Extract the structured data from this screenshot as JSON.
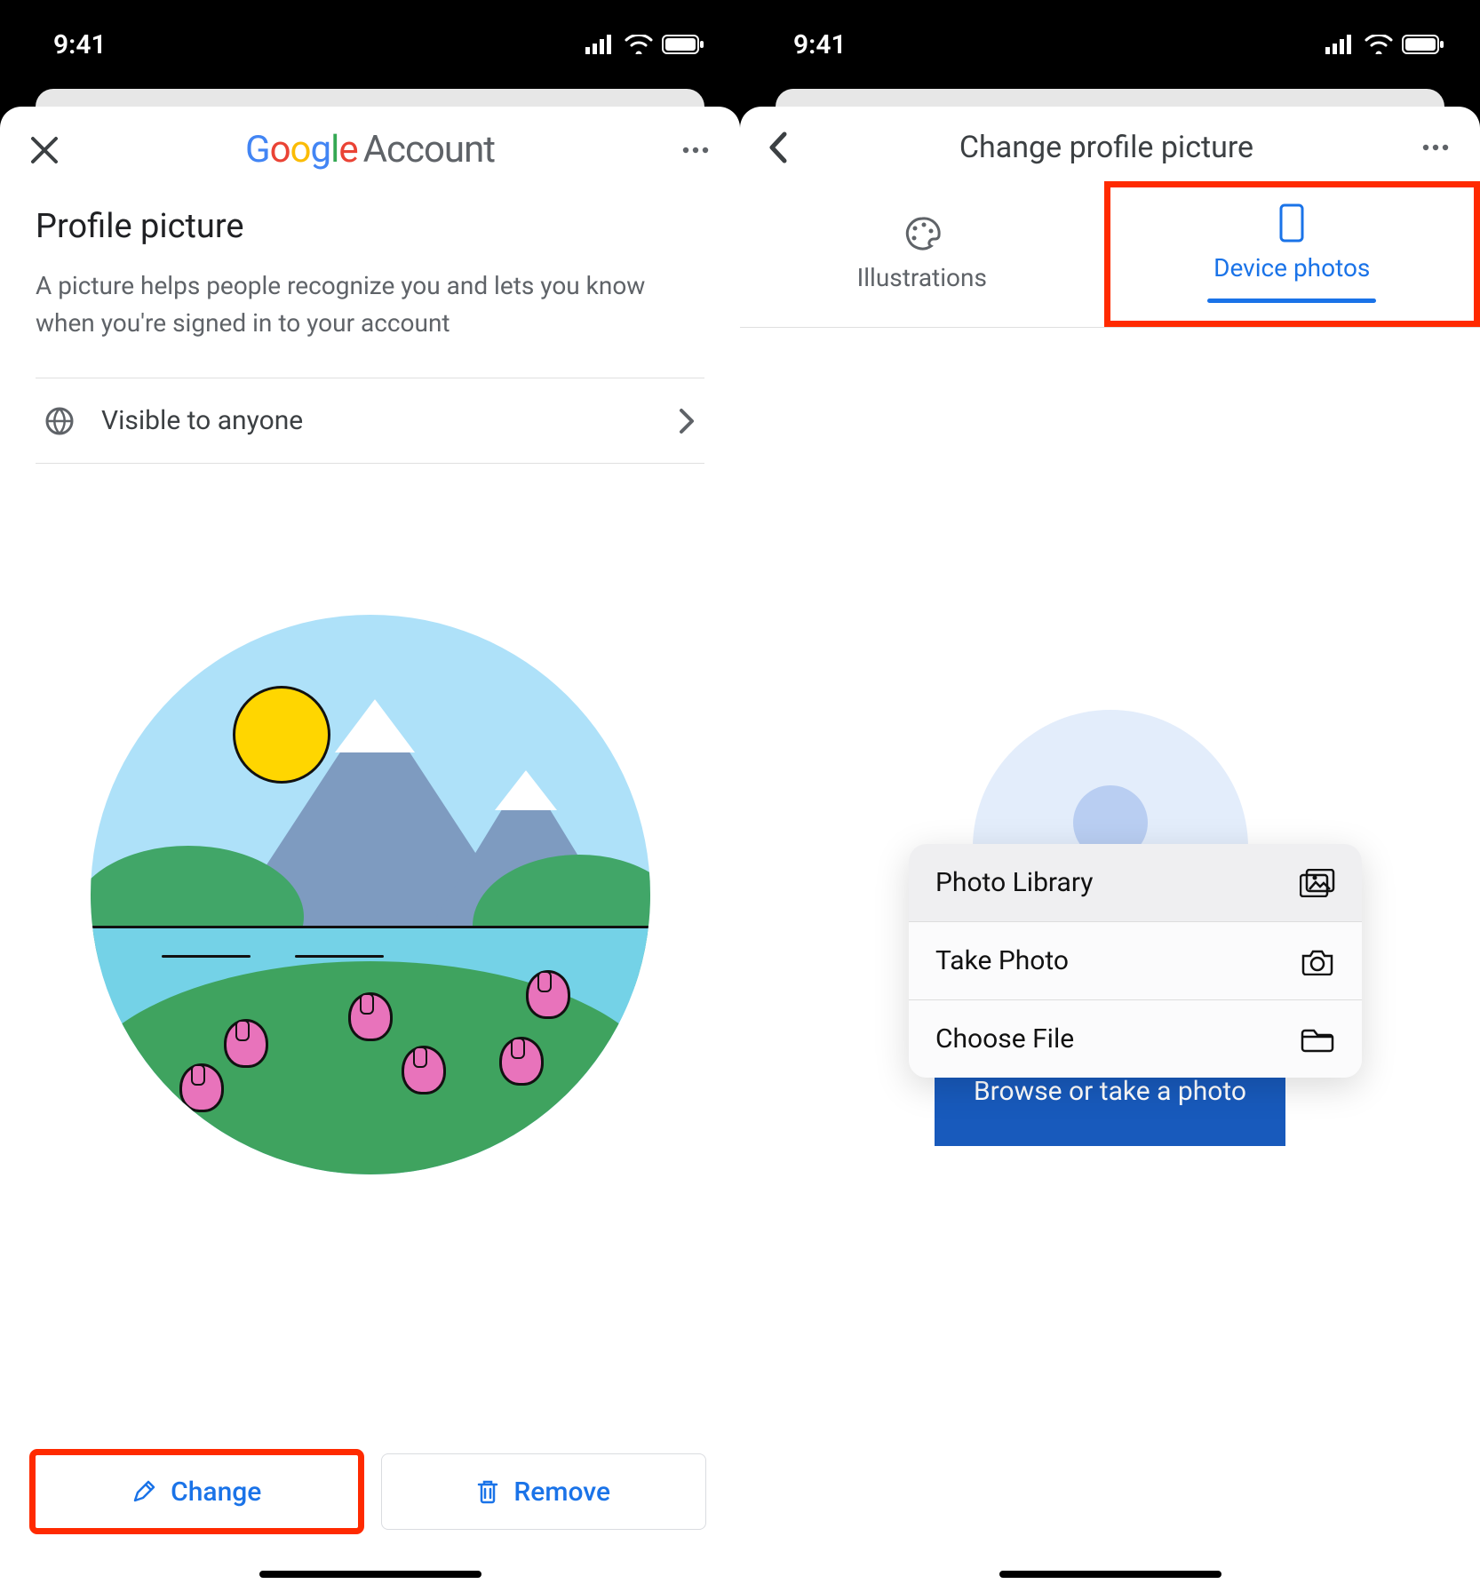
{
  "status": {
    "time": "9:41"
  },
  "screen1": {
    "header_brand_account": "Account",
    "title": "Profile picture",
    "desc": "A picture helps people recognize you and lets you know when you're signed in to your account",
    "visibility_label": "Visible to anyone",
    "change_label": "Change",
    "remove_label": "Remove"
  },
  "screen2": {
    "header_title": "Change profile picture",
    "tab_illustrations": "Illustrations",
    "tab_device": "Device photos",
    "browse_label": "Browse or take a photo",
    "actions": {
      "photo_library": "Photo Library",
      "take_photo": "Take Photo",
      "choose_file": "Choose File"
    }
  }
}
